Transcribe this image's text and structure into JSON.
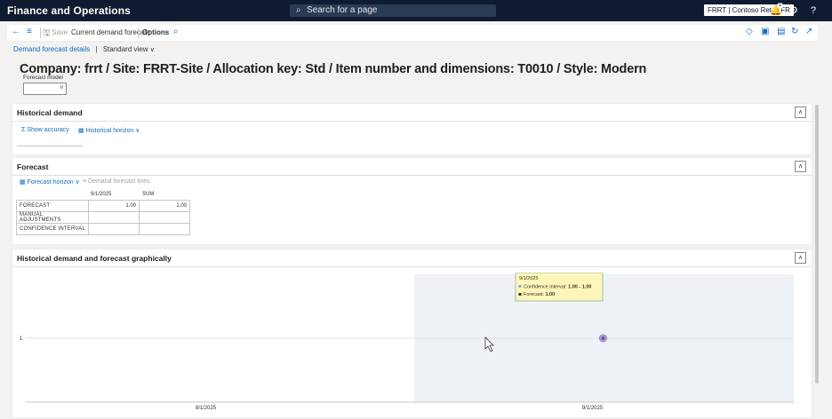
{
  "topbar": {
    "app_title": "Finance and Operations",
    "search_placeholder": "Search for a page",
    "company_label": "FRRT | Contoso Retail FR",
    "notifications_count": "1"
  },
  "actionbar": {
    "save_label": "Save",
    "current_label": "Current demand forecast",
    "options_label": "Options"
  },
  "breadcrumb": {
    "page": "Demand forecast details",
    "sep": "|",
    "view": "Standard view"
  },
  "page_title": "Company: frrt / Site: FRRT-Site / Allocation key: Std / Item number and dimensions: T0010 / Style: Modern",
  "forecast_model": {
    "label": "Forecast model",
    "value": ""
  },
  "historical": {
    "title": "Historical demand",
    "show_accuracy": "Show accuracy",
    "historical_horizon": "Historical horizon"
  },
  "forecast": {
    "title": "Forecast",
    "forecast_horizon": "Forecast horizon",
    "demand_lines": "Demand forecast lines",
    "columns": [
      "9/1/2025",
      "SUM"
    ],
    "rows": [
      {
        "label": "FORECAST",
        "values": [
          "1.00",
          "1.00"
        ]
      },
      {
        "label": "MANUAL ADJUSTMENTS",
        "values": [
          "",
          ""
        ]
      },
      {
        "label": "CONFIDENCE INTERVAL",
        "values": [
          "",
          ""
        ]
      }
    ]
  },
  "graph": {
    "title": "Historical demand and forecast graphically"
  },
  "chart_data": {
    "type": "scatter",
    "categories": [
      "8/1/2025",
      "9/1/2025"
    ],
    "y_ticks": [
      "1"
    ],
    "series": [
      {
        "name": "Forecast",
        "values": [
          null,
          1.0
        ]
      }
    ],
    "confidence_interval": {
      "x": "9/1/2025",
      "low": 1.0,
      "high": 1.0
    },
    "tooltip": {
      "date": "9/1/2025",
      "ci_label": "Confidence interval:",
      "ci_value": "1.00 - 1.00",
      "forecast_label": "Forecast:",
      "forecast_value": "1.00"
    },
    "forecast_region_color": "#eef2f7",
    "point_color": "#6b4fa0"
  }
}
